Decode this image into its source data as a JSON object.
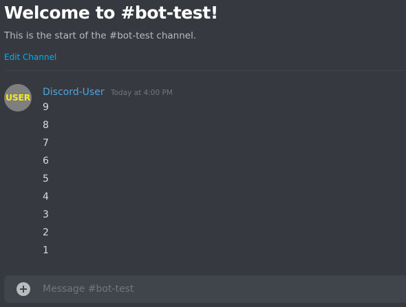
{
  "channel": {
    "welcome_title": "Welcome to #bot-test!",
    "welcome_subtitle": "This is the start of the #bot-test channel.",
    "edit_link": "Edit Channel"
  },
  "message": {
    "avatar_text": "USER",
    "username": "Discord-User",
    "timestamp": "Today at 4:00 PM",
    "lines": [
      "9",
      "8",
      "7",
      "6",
      "5",
      "4",
      "3",
      "2",
      "1"
    ]
  },
  "composer": {
    "placeholder": "Message #bot-test",
    "add_icon": "plus-circle-icon"
  },
  "colors": {
    "background": "#36393f",
    "link": "#00b0f4",
    "username": "#4fa4e0",
    "avatar_bg": "#7f7f7f",
    "avatar_text": "#f5ec1a",
    "composer_bg": "#40444b"
  }
}
